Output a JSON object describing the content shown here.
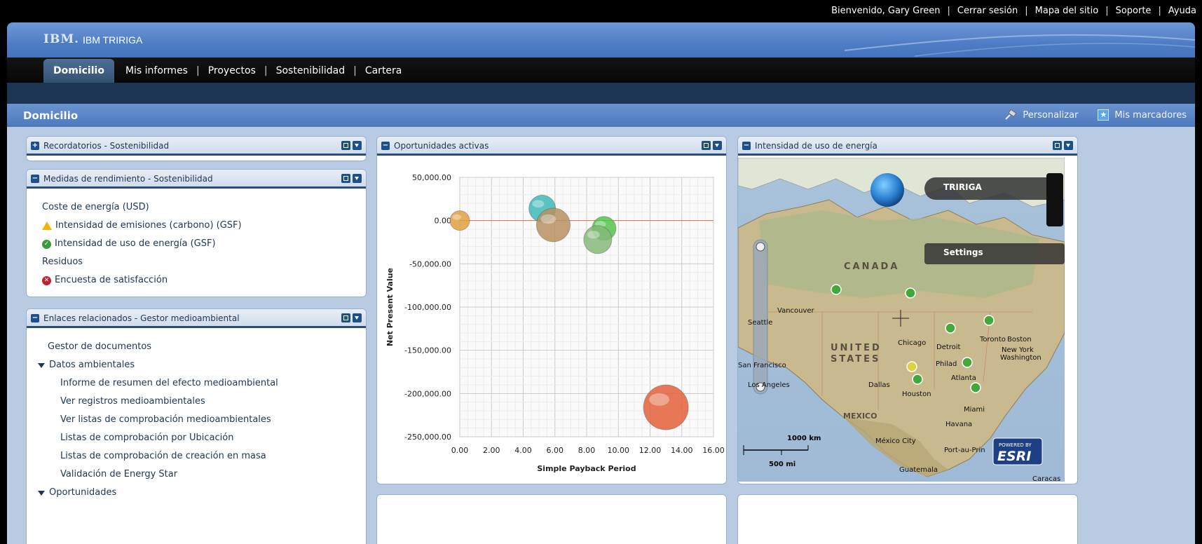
{
  "util_links": [
    "Bienvenido, Gary Green",
    "Cerrar sesión",
    "Mapa del sitio",
    "Soporte",
    "Ayuda"
  ],
  "brand": {
    "logo": "IBM.",
    "product": "IBM TRIRIGA"
  },
  "nav": {
    "active": "Domicilio",
    "links": [
      "Mis informes",
      "Proyectos",
      "Sostenibilidad",
      "Cartera"
    ]
  },
  "page": {
    "title": "Domicilio",
    "personalize": "Personalizar",
    "bookmarks": "Mis marcadores"
  },
  "portlets": {
    "reminders": {
      "title": "Recordatorios - Sostenibilidad"
    },
    "performance": {
      "title": "Medidas de rendimiento - Sostenibilidad",
      "items": [
        {
          "label": "Coste de energía (USD)",
          "status": "none"
        },
        {
          "label": "Intensidad de emisiones (carbono) (GSF)",
          "status": "warning"
        },
        {
          "label": "Intensidad de uso de energía (GSF)",
          "status": "ok"
        },
        {
          "label": "Residuos",
          "status": "none"
        },
        {
          "label": "Encuesta de satisfacción",
          "status": "error"
        }
      ]
    },
    "links": {
      "title": "Enlaces relacionados - Gestor medioambiental",
      "top": "Gestor de documentos",
      "group1": "Datos ambientales",
      "group1_items": [
        "Informe de resumen del efecto medioambiental",
        "Ver registros medioambientales",
        "Ver listas de comprobación medioambientales",
        "Listas de comprobación por Ubicación",
        "Listas de comprobación de creación en masa",
        "Validación de Energy Star"
      ],
      "group2": "Oportunidades"
    },
    "opportunities": {
      "title": "Oportunidades activas"
    },
    "energy": {
      "title": "Intensidad de uso de energía",
      "map_labels": {
        "tririga": "TRIRIGA",
        "settings": "Settings",
        "canada": "CANADA",
        "us": "UNITED",
        "us2": "STATES",
        "mexico": "MEXICO",
        "km": "1000 km",
        "mi": "500 mi",
        "esri_top": "POWERED BY",
        "esri": "ESRI",
        "cities": [
          "Vancouver",
          "Seattle",
          "Chicago",
          "Detroit",
          "Toronto",
          "Boston",
          "New York",
          "Washington",
          "Philad",
          "San Francisco",
          "Los Angeles",
          "Dallas",
          "Houston",
          "Atlanta",
          "Miami",
          "Havana",
          "México City",
          "Port-au-Prin",
          "Guatemala",
          "Caracas"
        ]
      }
    }
  },
  "chart_data": {
    "type": "scatter",
    "subtype": "bubble",
    "xlabel": "Simple Payback Period",
    "ylabel": "Net Present Value",
    "xlim": [
      0,
      16
    ],
    "ylim": [
      -250000,
      50000
    ],
    "xticks": [
      "0.00",
      "2.00",
      "4.00",
      "6.00",
      "8.00",
      "10.00",
      "12.00",
      "14.00",
      "16.00"
    ],
    "yticks": [
      "50,000.00",
      "0.00",
      "-50,000.00",
      "-100,000.00",
      "-150,000.00",
      "-200,000.00",
      "-250,000.00"
    ],
    "points": [
      {
        "x": 0.0,
        "y": 0,
        "size": 14,
        "color": "#e0a040"
      },
      {
        "x": 5.2,
        "y": 14000,
        "size": 19,
        "color": "#3fb8b8"
      },
      {
        "x": 5.9,
        "y": -5000,
        "size": 24,
        "color": "#b99060"
      },
      {
        "x": 9.1,
        "y": -9000,
        "size": 17,
        "color": "#52c44a"
      },
      {
        "x": 8.7,
        "y": -22000,
        "size": 20,
        "color": "#86b77a"
      },
      {
        "x": 13.0,
        "y": -216000,
        "size": 32,
        "color": "#e2603a"
      }
    ],
    "grid": true
  }
}
